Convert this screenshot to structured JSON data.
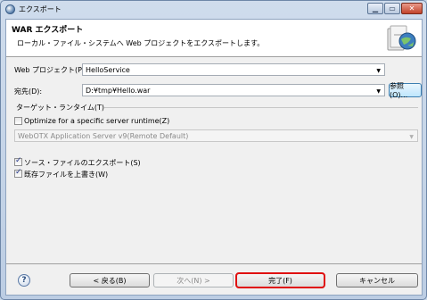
{
  "window": {
    "title": "エクスポート"
  },
  "banner": {
    "title": "WAR エクスポート",
    "description": "ローカル・ファイル・システムへ Web プロジェクトをエクスポートします。"
  },
  "form": {
    "project_label": "Web プロジェクト(P):",
    "project_value": "HelloService",
    "dest_label": "宛先(D):",
    "dest_value": "D:¥tmp¥Hello.war",
    "browse_label": "参照(O)...",
    "runtime_section": "ターゲット・ランタイム(T)",
    "optimize_label": "Optimize for a specific server runtime(Z)",
    "optimize_checked": false,
    "runtime_value": "WebOTX Application Server v9(Remote Default)",
    "export_source_label": "ソース・ファイルのエクスポート(S)",
    "export_source_checked": true,
    "overwrite_label": "既存ファイルを上書き(W)",
    "overwrite_checked": true
  },
  "footer": {
    "back_label": "< 戻る(B)",
    "next_label": "次へ(N) >",
    "finish_label": "完了(F)",
    "cancel_label": "キャンセル"
  }
}
